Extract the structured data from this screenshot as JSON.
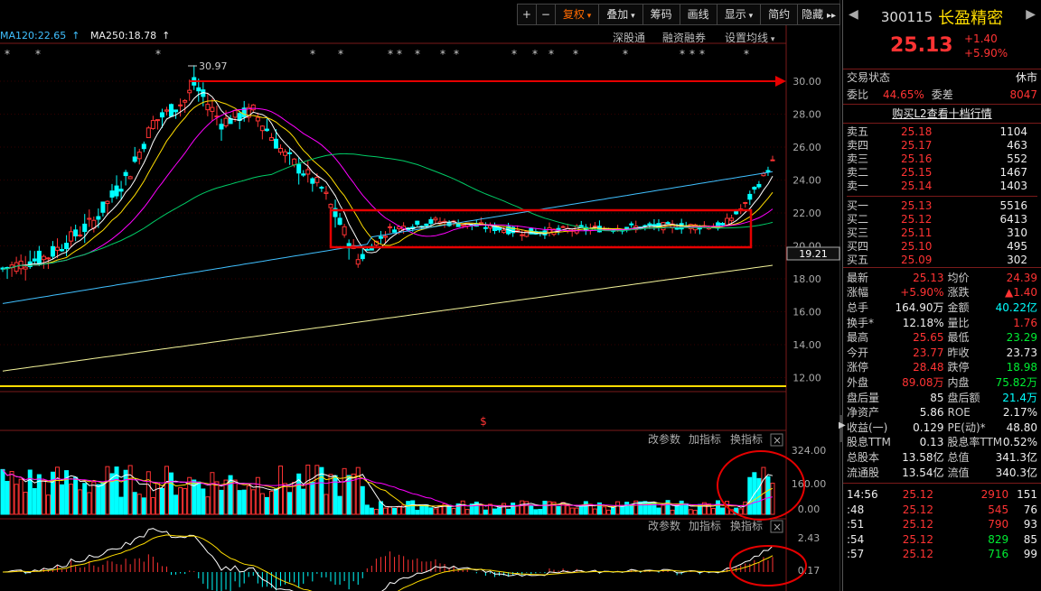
{
  "toolbar": {
    "plus": "+",
    "minus": "−",
    "fuquan": "复权",
    "overlay": "叠加",
    "chips": "筹码",
    "draw": "画线",
    "display": "显示",
    "simple": "简约",
    "hide": "隐藏",
    "more": "▸▸"
  },
  "ma": {
    "ma120": "MA120:22.65",
    "ma250": "MA250:18.78"
  },
  "links": {
    "hk": "深股通",
    "margin": "融资融券",
    "setma": "设置均线"
  },
  "chart": {
    "high_label": "30.97",
    "price_ticks": [
      "30.00",
      "28.00",
      "26.00",
      "24.00",
      "22.00",
      "20.00",
      "18.00",
      "16.00",
      "14.00",
      "12.00"
    ],
    "current_tag": "19.21",
    "vol_ticks": [
      "324.00",
      "160.00",
      "0.00"
    ],
    "macd_ticks": [
      "2.43",
      "0.17"
    ],
    "indicator_links": [
      "改参数",
      "加指标",
      "换指标"
    ],
    "indicator_links2": [
      "改参数",
      "加指标",
      "换指标"
    ],
    "mark": "$",
    "close": "×"
  },
  "colors": {
    "up": "#ff3333",
    "down": "#00ffff",
    "annot": "#e60000"
  },
  "stock": {
    "code": "300115",
    "name": "长盈精密",
    "price": "25.13",
    "change": "+1.40",
    "change_pct": "+5.90%"
  },
  "trade_status": {
    "label": "交易状态",
    "value": "休市"
  },
  "weibi": {
    "label": "委比",
    "value": "44.65%",
    "label2": "委差",
    "value2": "8047"
  },
  "l2": "购买L2查看十档行情",
  "asks": [
    {
      "label": "卖五",
      "price": "25.18",
      "vol": "1104"
    },
    {
      "label": "卖四",
      "price": "25.17",
      "vol": "463"
    },
    {
      "label": "卖三",
      "price": "25.16",
      "vol": "552"
    },
    {
      "label": "卖二",
      "price": "25.15",
      "vol": "1467"
    },
    {
      "label": "卖一",
      "price": "25.14",
      "vol": "1403"
    }
  ],
  "bids": [
    {
      "label": "买一",
      "price": "25.13",
      "vol": "5516"
    },
    {
      "label": "买二",
      "price": "25.12",
      "vol": "6413"
    },
    {
      "label": "买三",
      "price": "25.11",
      "vol": "310"
    },
    {
      "label": "买四",
      "price": "25.10",
      "vol": "495"
    },
    {
      "label": "买五",
      "price": "25.09",
      "vol": "302"
    }
  ],
  "stats": [
    {
      "l1": "最新",
      "v1": "25.13",
      "c1": "red",
      "l2": "均价",
      "v2": "24.39",
      "c2": "red"
    },
    {
      "l1": "涨幅",
      "v1": "+5.90%",
      "c1": "red",
      "l2": "涨跌",
      "v2": "▲1.40",
      "c2": "red"
    },
    {
      "l1": "总手",
      "v1": "164.90万",
      "c1": "white",
      "l2": "金额",
      "v2": "40.22亿",
      "c2": "cyan"
    },
    {
      "l1": "换手*",
      "v1": "12.18%",
      "c1": "white",
      "l2": "量比",
      "v2": "1.76",
      "c2": "red"
    },
    {
      "l1": "最高",
      "v1": "25.65",
      "c1": "red",
      "l2": "最低",
      "v2": "23.29",
      "c2": "green"
    },
    {
      "l1": "今开",
      "v1": "23.77",
      "c1": "red",
      "l2": "昨收",
      "v2": "23.73",
      "c2": "white"
    },
    {
      "l1": "涨停",
      "v1": "28.48",
      "c1": "red",
      "l2": "跌停",
      "v2": "18.98",
      "c2": "green"
    },
    {
      "l1": "外盘",
      "v1": "89.08万",
      "c1": "red",
      "l2": "内盘",
      "v2": "75.82万",
      "c2": "green"
    },
    {
      "l1": "盘后量",
      "v1": "85",
      "c1": "white",
      "l2": "盘后额",
      "v2": "21.4万",
      "c2": "cyan"
    },
    {
      "l1": "净资产",
      "v1": "5.86",
      "c1": "white",
      "l2": "ROE",
      "v2": "2.17%",
      "c2": "white"
    },
    {
      "l1": "收益(一)",
      "v1": "0.129",
      "c1": "white",
      "l2": "PE(动)*",
      "v2": "48.80",
      "c2": "white"
    },
    {
      "l1": "股息TTM",
      "v1": "0.13",
      "c1": "white",
      "l2": "股息率TTM",
      "v2": "0.52%",
      "c2": "white"
    },
    {
      "l1": "总股本",
      "v1": "13.58亿",
      "c1": "white",
      "l2": "总值",
      "v2": "341.3亿",
      "c2": "white"
    },
    {
      "l1": "流通股",
      "v1": "13.54亿",
      "c1": "white",
      "l2": "流值",
      "v2": "340.3亿",
      "c2": "white"
    }
  ],
  "ticks": [
    {
      "t": "14:56",
      "p": "25.12",
      "v": "2910",
      "n": "151",
      "vc": "red"
    },
    {
      "t": ":48",
      "p": "25.12",
      "v": "545",
      "n": "76",
      "vc": "red"
    },
    {
      "t": ":51",
      "p": "25.12",
      "v": "790",
      "n": "93",
      "vc": "red"
    },
    {
      "t": ":54",
      "p": "25.12",
      "v": "829",
      "n": "85",
      "vc": "green"
    },
    {
      "t": ":57",
      "p": "25.12",
      "v": "716",
      "n": "99",
      "vc": "green"
    }
  ]
}
